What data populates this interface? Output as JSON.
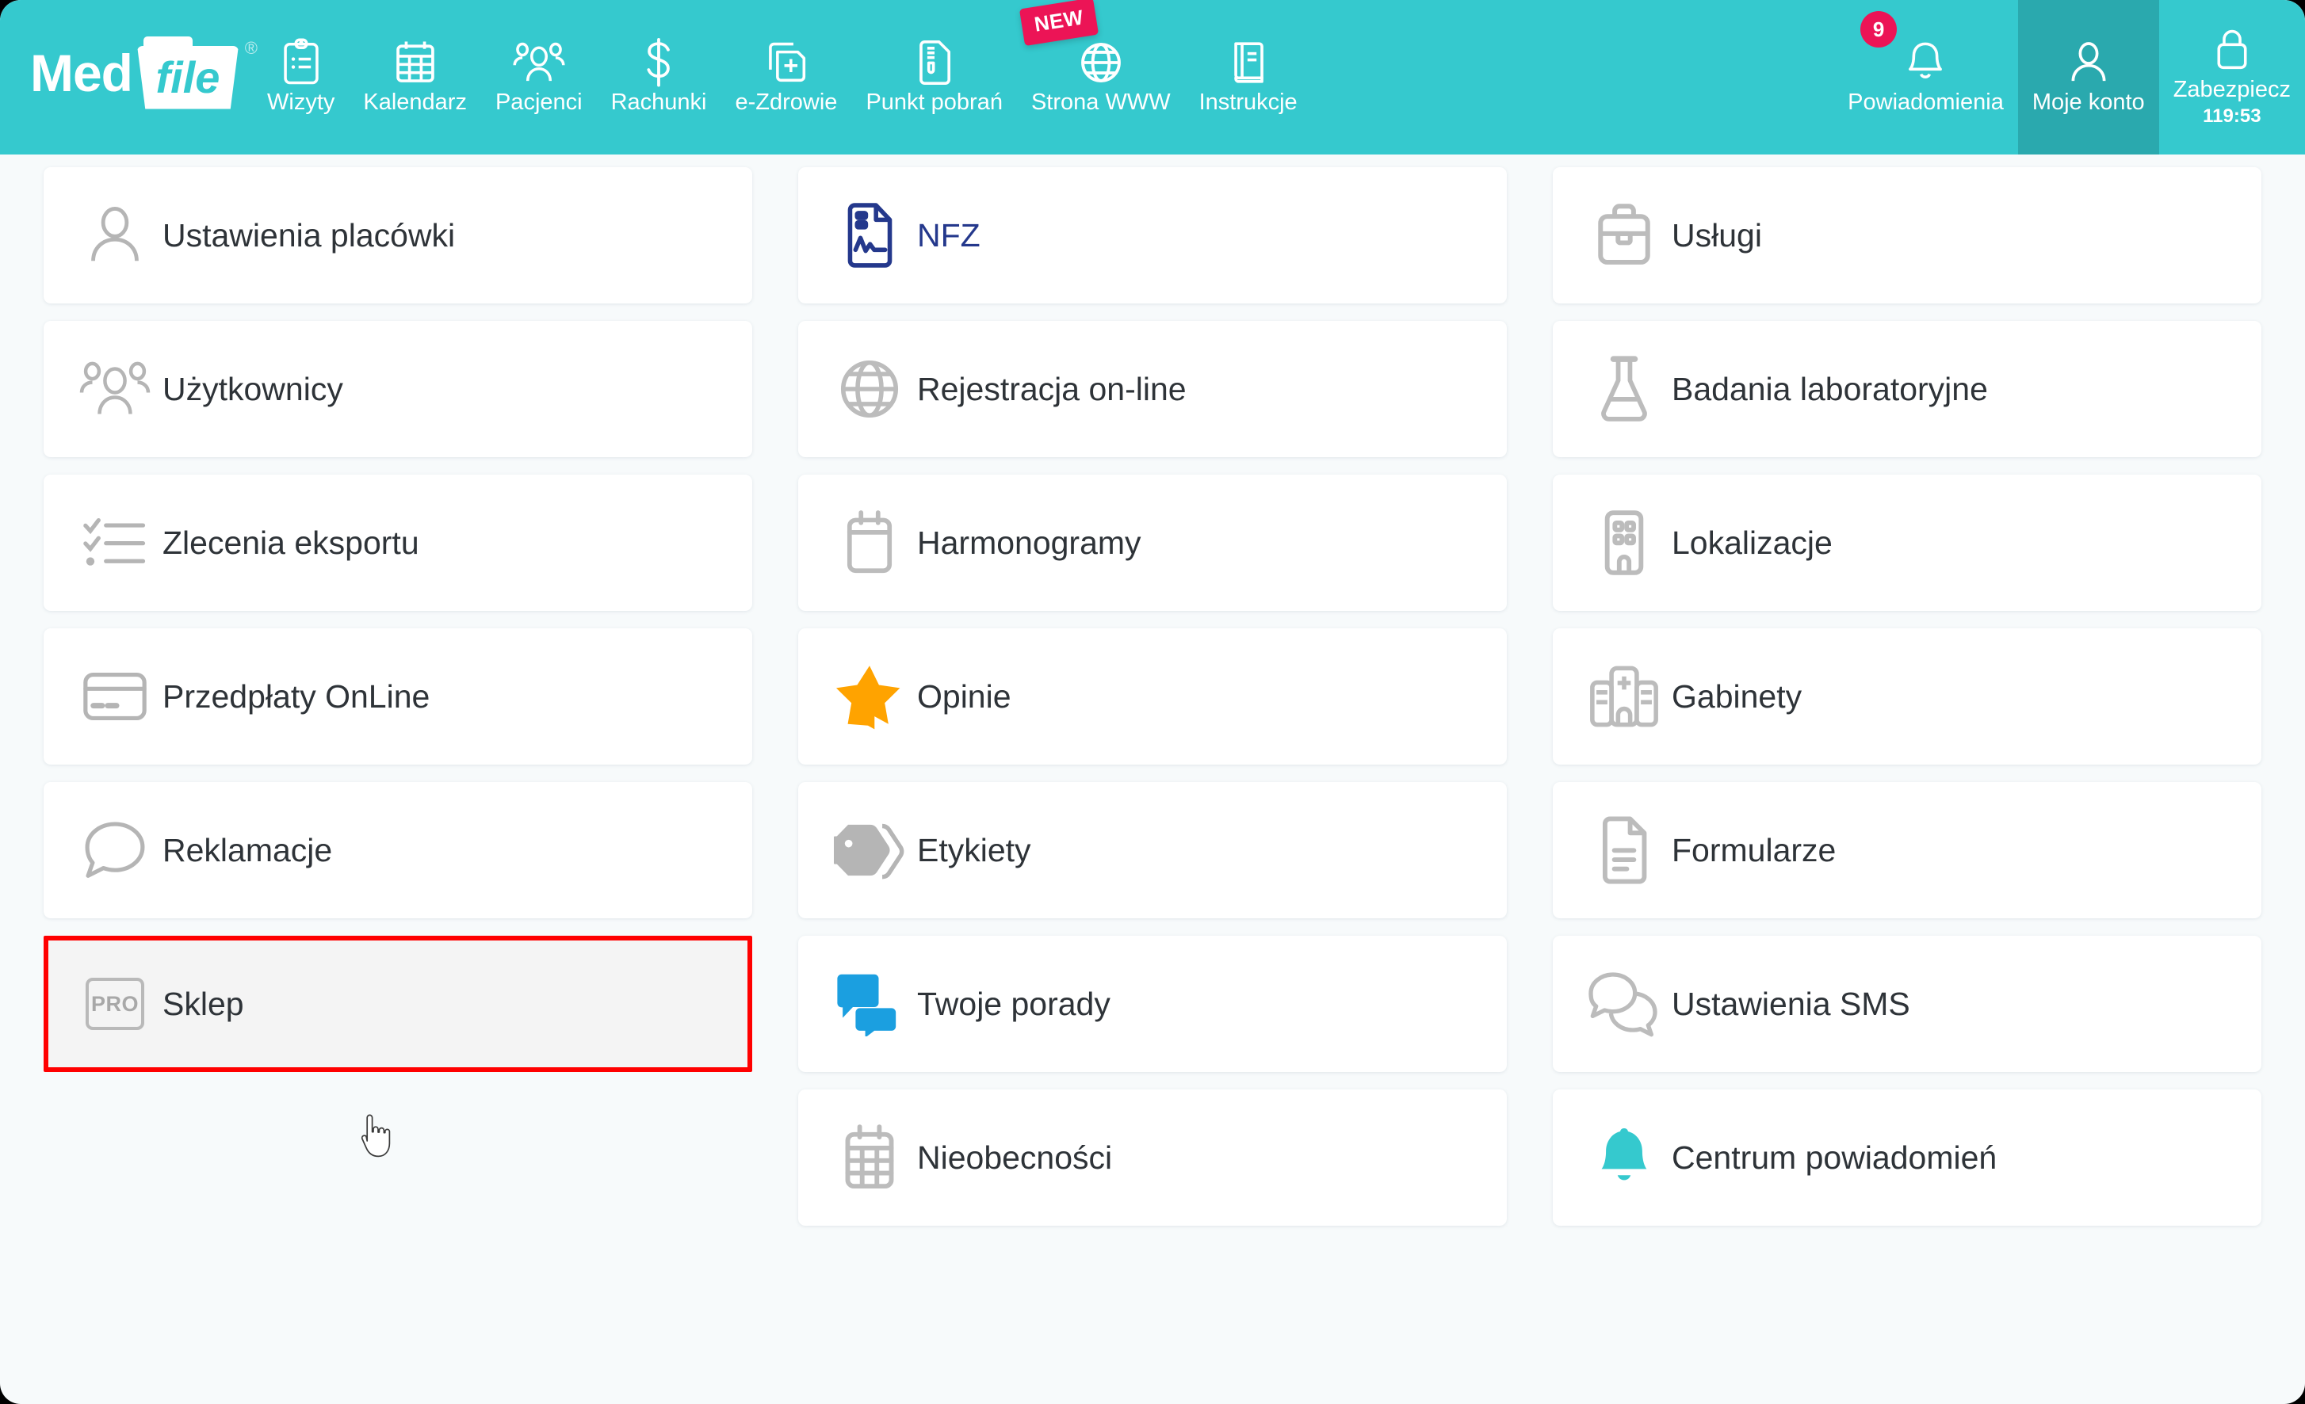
{
  "brand": {
    "name_part1": "Med",
    "name_part2": "file",
    "registered": "®",
    "accent_teal": "#35c9ce",
    "accent_pink": "#ec1456",
    "highlight_red": "#ff0000"
  },
  "topnav": {
    "items": [
      {
        "label": "Wizyty",
        "icon": "clipboard-list-icon",
        "active": false
      },
      {
        "label": "Kalendarz",
        "icon": "calendar-grid-icon",
        "active": false
      },
      {
        "label": "Pacjenci",
        "icon": "people-group-icon",
        "active": false
      },
      {
        "label": "Rachunki",
        "icon": "dollar-sign-icon",
        "active": false
      },
      {
        "label": "e-Zdrowie",
        "icon": "document-plus-icon",
        "active": false
      },
      {
        "label": "Punkt pobrań",
        "icon": "document-tube-icon",
        "active": false
      },
      {
        "label": "Strona WWW",
        "icon": "globe-icon",
        "active": false,
        "badge_new": "NEW"
      },
      {
        "label": "Instrukcje",
        "icon": "book-icon",
        "active": false
      }
    ],
    "right_items": [
      {
        "label": "Powiadomienia",
        "icon": "bell-icon",
        "active": false,
        "badge_count": "9"
      },
      {
        "label": "Moje konto",
        "icon": "person-icon",
        "active": true
      },
      {
        "label": "Zabezpiecz",
        "icon": "lock-icon",
        "active": false,
        "timer": "119:53"
      }
    ]
  },
  "grid": {
    "columns": [
      {
        "cards": [
          {
            "label": "Ustawienia placówki",
            "icon": "person-outline-icon",
            "icon_color": "#b5b5b5",
            "label_color": "#2e3338",
            "highlighted": false
          },
          {
            "label": "Użytkownicy",
            "icon": "people-group-icon",
            "icon_color": "#b5b5b5",
            "label_color": "#2e3338",
            "highlighted": false
          },
          {
            "label": "Zlecenia eksportu",
            "icon": "checklist-icon",
            "icon_color": "#b5b5b5",
            "label_color": "#2e3338",
            "highlighted": false
          },
          {
            "label": "Przedpłaty OnLine",
            "icon": "credit-card-icon",
            "icon_color": "#b5b5b5",
            "label_color": "#2e3338",
            "highlighted": false
          },
          {
            "label": "Reklamacje",
            "icon": "speech-bubble-icon",
            "icon_color": "#b5b5b5",
            "label_color": "#2e3338",
            "highlighted": false
          },
          {
            "label": "Sklep",
            "icon": "pro-badge-icon",
            "icon_color": "#a8a8a8",
            "label_color": "#2e3338",
            "highlighted": true,
            "pro_text": "PRO"
          }
        ]
      },
      {
        "cards": [
          {
            "label": "NFZ",
            "icon": "nfz-document-icon",
            "icon_color": "#24388c",
            "label_color": "#24388c",
            "highlighted": false
          },
          {
            "label": "Rejestracja on-line",
            "icon": "globe-icon",
            "icon_color": "#bcbcbc",
            "label_color": "#2e3338",
            "highlighted": false
          },
          {
            "label": "Harmonogramy",
            "icon": "calendar-plain-icon",
            "icon_color": "#bcbcbc",
            "label_color": "#2e3338",
            "highlighted": false
          },
          {
            "label": "Opinie",
            "icon": "star-filled-icon",
            "icon_color": "#ffa300",
            "label_color": "#2e3338",
            "highlighted": false
          },
          {
            "label": "Etykiety",
            "icon": "tag-filled-icon",
            "icon_color": "#b5b5b5",
            "label_color": "#2e3338",
            "highlighted": false
          },
          {
            "label": "Twoje porady",
            "icon": "chat-bubbles-icon",
            "icon_color": "#1b9fe0",
            "label_color": "#2e3338",
            "highlighted": false
          },
          {
            "label": "Nieobecności",
            "icon": "calendar-grid-icon",
            "icon_color": "#bcbcbc",
            "label_color": "#2e3338",
            "highlighted": false
          }
        ]
      },
      {
        "cards": [
          {
            "label": "Usługi",
            "icon": "briefcase-icon",
            "icon_color": "#bcbcbc",
            "label_color": "#2e3338",
            "highlighted": false
          },
          {
            "label": "Badania laboratoryjne",
            "icon": "flask-icon",
            "icon_color": "#bcbcbc",
            "label_color": "#2e3338",
            "highlighted": false
          },
          {
            "label": "Lokalizacje",
            "icon": "building-icon",
            "icon_color": "#bcbcbc",
            "label_color": "#2e3338",
            "highlighted": false
          },
          {
            "label": "Gabinety",
            "icon": "hospital-icon",
            "icon_color": "#bcbcbc",
            "label_color": "#2e3338",
            "highlighted": false
          },
          {
            "label": "Formularze",
            "icon": "document-lines-icon",
            "icon_color": "#bcbcbc",
            "label_color": "#2e3338",
            "highlighted": false
          },
          {
            "label": "Ustawienia SMS",
            "icon": "two-bubbles-icon",
            "icon_color": "#bcbcbc",
            "label_color": "#2e3338",
            "highlighted": false
          },
          {
            "label": "Centrum powiadomień",
            "icon": "bell-filled-icon",
            "icon_color": "#35c9ce",
            "label_color": "#2e3338",
            "highlighted": false
          }
        ]
      }
    ]
  }
}
